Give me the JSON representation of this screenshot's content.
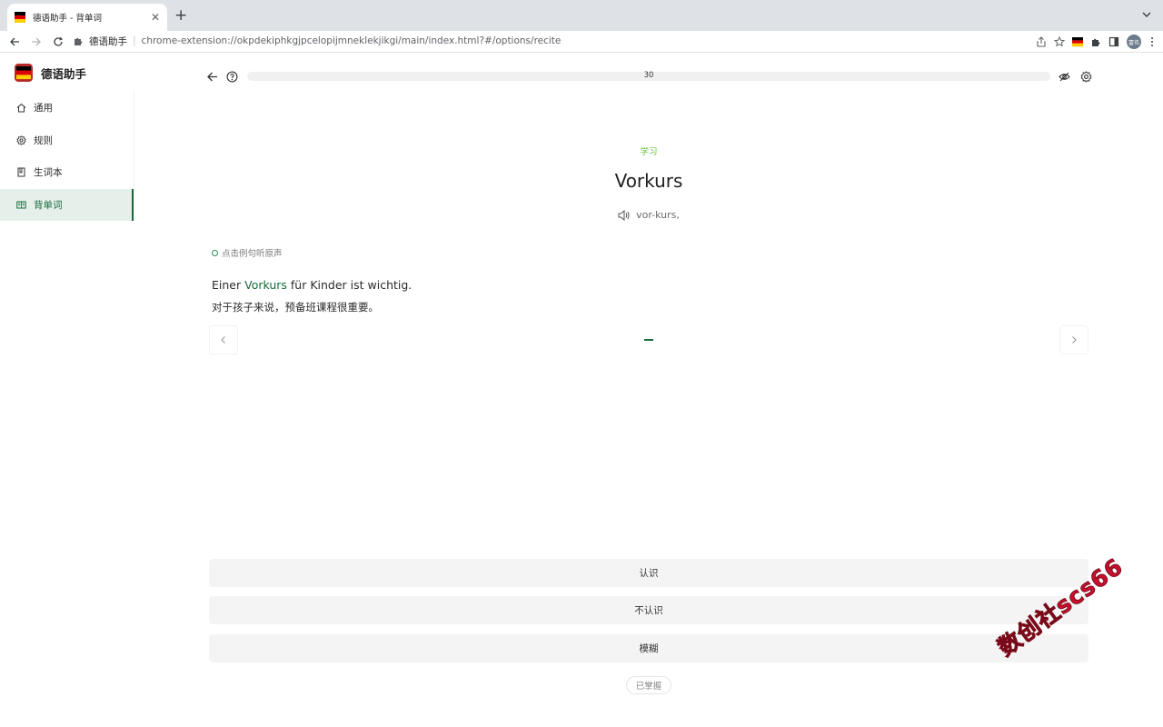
{
  "browser": {
    "tab_title": "德语助手 - 背单词",
    "address_ext_label": "德语助手",
    "address_url": "chrome-extension://okpdekiphkgjpcelopijmneklekjikgi/main/index.html?#/options/recite",
    "avatar_text": "富伟"
  },
  "app": {
    "name": "德语助手",
    "flag_colors": [
      "#000000",
      "#dd0000",
      "#ffce00"
    ],
    "accent_color": "#186a3b"
  },
  "sidebar": {
    "items": [
      {
        "label": "通用",
        "icon": "home-icon",
        "active": false
      },
      {
        "label": "规则",
        "icon": "gear-icon",
        "active": false
      },
      {
        "label": "生词本",
        "icon": "book-icon",
        "active": false
      },
      {
        "label": "背单词",
        "icon": "reader-icon",
        "active": true
      }
    ]
  },
  "recite": {
    "progress_label": "30",
    "progress_fraction": 0,
    "tag": "学习",
    "word": "Vorkurs",
    "pronunciation": "vor-kurs,",
    "hint": "点击例句听原声",
    "example": {
      "before": "Einer ",
      "highlight": "Vorkurs",
      "after": " für Kinder ist wichtig.",
      "translation": "对于孩子来说，预备班课程很重要。"
    },
    "actions": {
      "know": "认识",
      "dont_know": "不认识",
      "vague": "模糊",
      "mastered": "已掌握"
    }
  },
  "watermark": "数创社scs66"
}
